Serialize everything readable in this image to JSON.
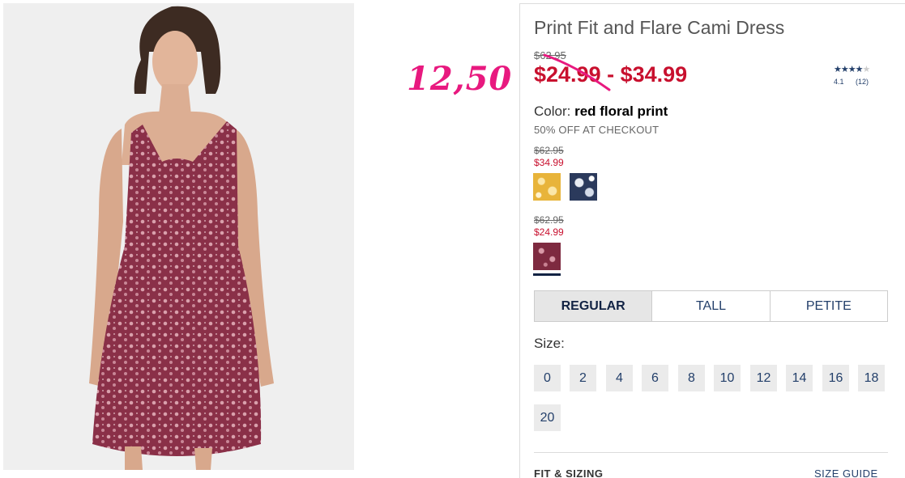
{
  "annotation": {
    "text": "12,50",
    "color": "#e8197f"
  },
  "product": {
    "title": "Print Fit and Flare Cami Dress",
    "original_price": "$62.95",
    "price_range": "$24.99 - $34.99",
    "rating": {
      "stars": 4,
      "max": 5,
      "value": "4.1",
      "count": "(12)"
    },
    "color_label": "Color:",
    "color_value": "red floral print",
    "promo": "50% OFF AT CHECKOUT"
  },
  "price_groups": [
    {
      "original": "$62.95",
      "sale": "$34.99",
      "swatches": [
        "yellow floral print",
        "navy floral print"
      ]
    },
    {
      "original": "$62.95",
      "sale": "$24.99",
      "swatches": [
        "red floral print"
      ]
    }
  ],
  "fit_tabs": [
    {
      "label": "REGULAR",
      "active": true
    },
    {
      "label": "TALL",
      "active": false
    },
    {
      "label": "PETITE",
      "active": false
    }
  ],
  "size_label": "Size:",
  "sizes": [
    "0",
    "2",
    "4",
    "6",
    "8",
    "10",
    "12",
    "14",
    "16",
    "18",
    "20"
  ],
  "footer": {
    "fit_sizing": "FIT & SIZING",
    "size_guide": "SIZE GUIDE"
  },
  "colors": {
    "sale_red": "#c8102e",
    "link_navy": "#24406b",
    "selected_underline": "#122344"
  }
}
